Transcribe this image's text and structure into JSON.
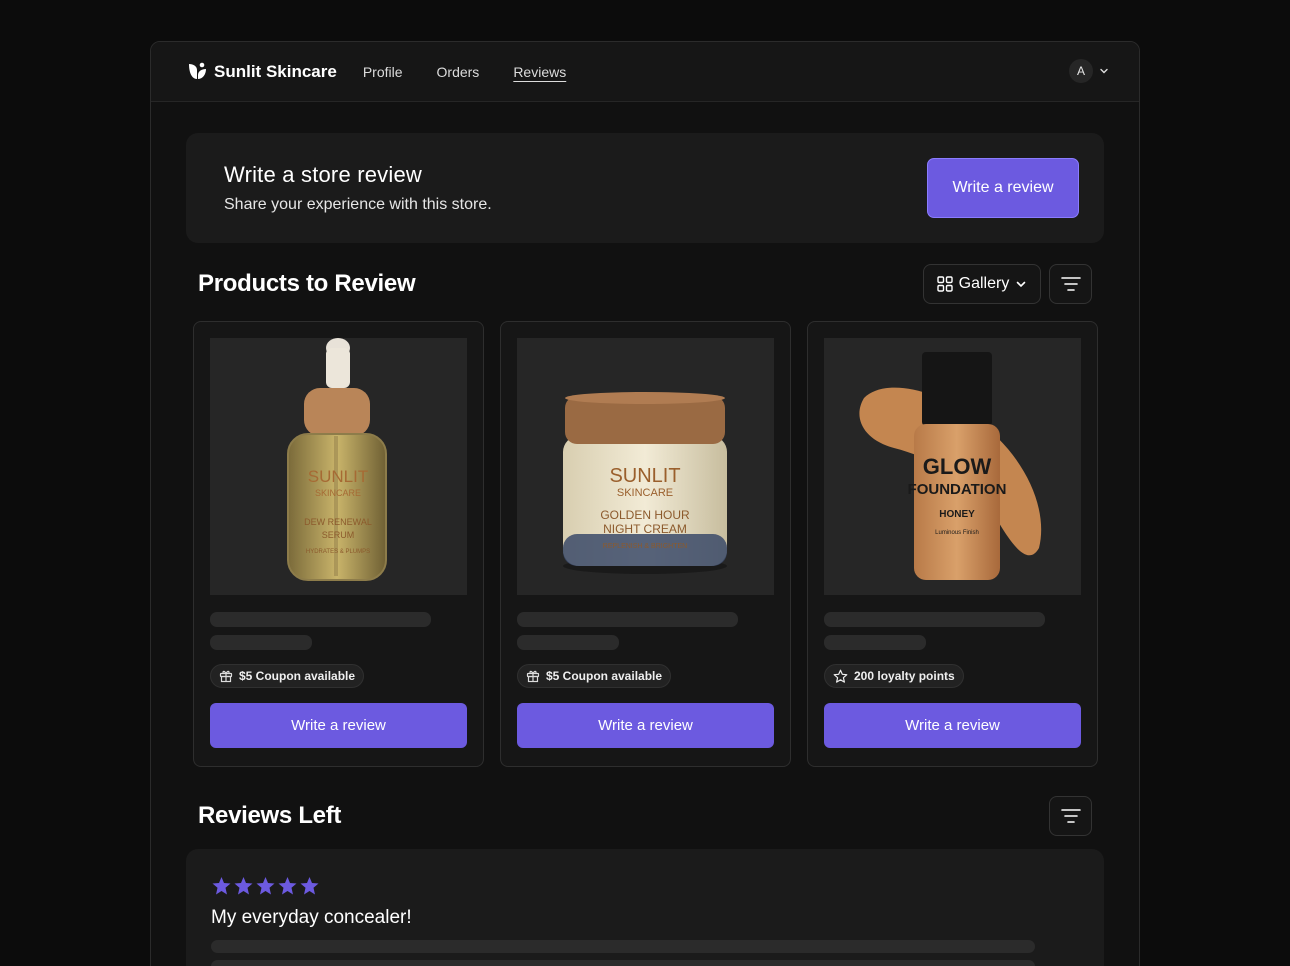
{
  "nav": {
    "brand": "Sunlit Skincare",
    "links": [
      "Profile",
      "Orders",
      "Reviews"
    ],
    "active": "Reviews",
    "avatar_initial": "A"
  },
  "store_review": {
    "title": "Write a store review",
    "subtitle": "Share your experience with this store.",
    "button": "Write a review"
  },
  "products_section": {
    "title": "Products to Review",
    "view_mode": "Gallery",
    "icons": [
      "grid-icon",
      "chevron-down-icon",
      "filter-icon"
    ]
  },
  "products": [
    {
      "image_label": [
        "SUNLIT",
        "SKINCARE",
        "DEW RENEWAL",
        "SERUM",
        "HYDRATES & PLUMPS"
      ],
      "reward_icon": "gift-icon",
      "reward": "$5 Coupon available",
      "button": "Write a review"
    },
    {
      "image_label": [
        "SUNLIT",
        "SKINCARE",
        "GOLDEN HOUR",
        "NIGHT CREAM",
        "REPLENISH & BRIGHTEN"
      ],
      "reward_icon": "gift-icon",
      "reward": "$5 Coupon available",
      "button": "Write a review"
    },
    {
      "image_label": [
        "GLOW",
        "FOUNDATION",
        "HONEY",
        "Luminous Finish"
      ],
      "reward_icon": "star-icon",
      "reward": "200 loyalty points",
      "button": "Write a review"
    }
  ],
  "reviews_section": {
    "title": "Reviews Left",
    "reviews": [
      {
        "rating": 5,
        "title": "My everyday concealer!"
      }
    ]
  },
  "colors": {
    "accent": "#6c5ae0",
    "background": "#0c0c0c",
    "card": "#161616",
    "star": "#6c5ae0"
  }
}
